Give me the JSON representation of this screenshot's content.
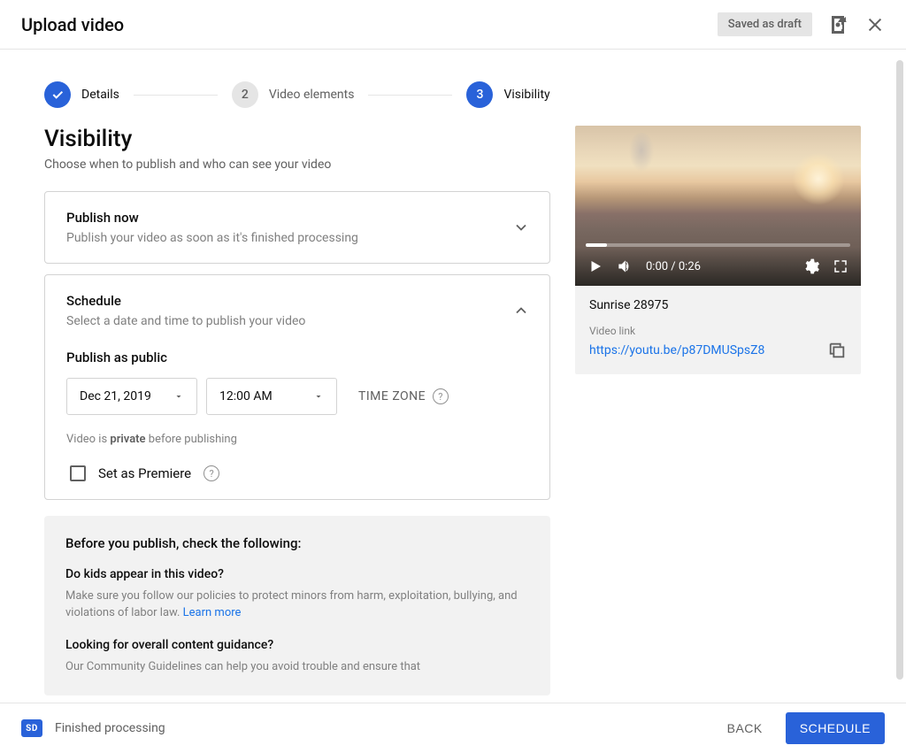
{
  "header": {
    "title": "Upload video",
    "draft_badge": "Saved as draft"
  },
  "stepper": {
    "step1": {
      "label": "Details"
    },
    "step2": {
      "number": "2",
      "label": "Video elements"
    },
    "step3": {
      "number": "3",
      "label": "Visibility"
    }
  },
  "visibility": {
    "title": "Visibility",
    "subtitle": "Choose when to publish and who can see your video"
  },
  "publish_now": {
    "title": "Publish now",
    "desc": "Publish your video as soon as it's finished processing"
  },
  "schedule": {
    "title": "Schedule",
    "desc": "Select a date and time to publish your video",
    "publish_label": "Publish as public",
    "date_value": "Dec 21, 2019",
    "time_value": "12:00 AM",
    "tz_label": "TIME ZONE",
    "private_note_prefix": "Video is ",
    "private_note_bold": "private",
    "private_note_suffix": " before publishing",
    "premiere_label": "Set as Premiere"
  },
  "checklist": {
    "heading": "Before you publish, check the following:",
    "kids_q": "Do kids appear in this video?",
    "kids_desc": "Make sure you follow our policies to protect minors from harm, exploitation, bullying, and violations of labor law. ",
    "learn_more": "Learn more",
    "guidance_q": "Looking for overall content guidance?",
    "guidance_desc": "Our Community Guidelines can help you avoid trouble and ensure that"
  },
  "preview": {
    "time_display": "0:00 / 0:26",
    "video_title": "Sunrise 28975",
    "link_label": "Video link",
    "link_url": "https://youtu.be/p87DMUSpsZ8"
  },
  "footer": {
    "sd_badge": "SD",
    "status": "Finished processing",
    "back": "BACK",
    "schedule": "SCHEDULE"
  }
}
